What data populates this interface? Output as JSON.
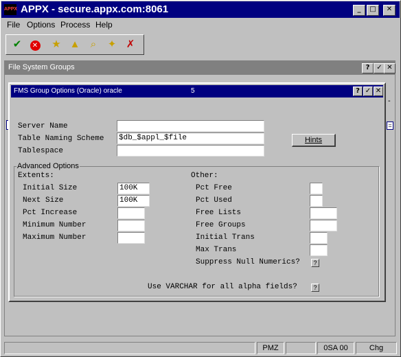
{
  "app": {
    "title": "APPX - secure.appx.com:8061",
    "logo_text": "APPX"
  },
  "menu": [
    "File",
    "Options",
    "Process",
    "Help"
  ],
  "toolbar_icons": [
    "check-icon",
    "stop-icon",
    "folder-star-icon",
    "folder-up-icon",
    "folder-search-icon",
    "folder-star2-icon",
    "folder-delete-icon"
  ],
  "outer_window": {
    "title": "File System Groups"
  },
  "dialog": {
    "title": "FMS Group Options (Oracle) oracle",
    "number": "5",
    "server_name_label": "Server Name",
    "server_name_value": "",
    "naming_scheme_label": "Table Naming Scheme",
    "naming_scheme_value": "$db_$appl_$file",
    "tablespace_label": "Tablespace",
    "tablespace_value": "",
    "hints_label": "Hints",
    "advanced_legend": "Advanced Options",
    "extents_label": "Extents:",
    "initial_size_label": "Initial Size",
    "initial_size_value": "100K",
    "next_size_label": "Next Size",
    "next_size_value": "100K",
    "pct_increase_label": "Pct Increase",
    "pct_increase_value": "",
    "minimum_number_label": "Minimum Number",
    "minimum_number_value": "",
    "maximum_number_label": "Maximum Number",
    "maximum_number_value": "",
    "other_label": "Other:",
    "pct_free_label": "Pct Free",
    "pct_free_value": "",
    "pct_used_label": "Pct Used",
    "pct_used_value": "",
    "free_lists_label": "Free Lists",
    "free_lists_value": "",
    "free_groups_label": "Free Groups",
    "free_groups_value": "",
    "initial_trans_label": "Initial Trans",
    "initial_trans_value": "",
    "max_trans_label": "Max Trans",
    "max_trans_value": "",
    "suppress_null_label": "Suppress Null Numerics?",
    "suppress_null_value": "?",
    "varchar_label": "Use VARCHAR for all alpha fields?",
    "varchar_value": "?"
  },
  "status_bar": {
    "cells": [
      "",
      "PMZ",
      "",
      "0SA 00",
      "Chg"
    ]
  }
}
